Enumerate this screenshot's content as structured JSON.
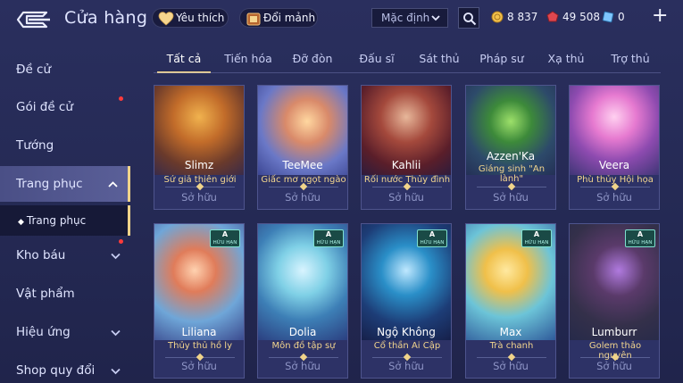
{
  "header": {
    "title": "Cửa hàng",
    "favorites_label": "Yêu thích",
    "exchange_label": "Đổi mảnh",
    "sort_value": "Mặc định",
    "currencies": {
      "gold": "8 837",
      "ruby": "49 508",
      "voucher": "0"
    }
  },
  "sidebar": {
    "items": [
      {
        "label": "Đề cử"
      },
      {
        "label": "Gói đề cử"
      },
      {
        "label": "Tướng"
      },
      {
        "label": "Trang phục"
      },
      {
        "label": "Kho báu"
      },
      {
        "label": "Vật phẩm"
      },
      {
        "label": "Hiệu ứng"
      },
      {
        "label": "Shop quy đổi"
      }
    ],
    "sub_item": "Trang phục"
  },
  "tabs": [
    {
      "label": "Tất cả"
    },
    {
      "label": "Tiến hóa"
    },
    {
      "label": "Đỡ đòn"
    },
    {
      "label": "Đấu sĩ"
    },
    {
      "label": "Sát thủ"
    },
    {
      "label": "Pháp sư"
    },
    {
      "label": "Xạ thủ"
    },
    {
      "label": "Trợ thủ"
    }
  ],
  "cards": [
    {
      "name": "Slimz",
      "skin": "Sứ giả thiên giới",
      "status": "Sở hữu"
    },
    {
      "name": "TeeMee",
      "skin": "Giấc mơ ngọt ngào",
      "status": "Sở hữu"
    },
    {
      "name": "Kahlii",
      "skin": "Rối nước Thủy đình",
      "status": "Sở hữu"
    },
    {
      "name": "Azzen'Ka",
      "skin": "Giáng sinh \"An lành\"",
      "status": "Sở hữu"
    },
    {
      "name": "Veera",
      "skin": "Phù thủy Hội họa",
      "status": "Sở hữu"
    },
    {
      "name": "Liliana",
      "skin": "Thủy thủ hồ ly",
      "status": "Sở hữu",
      "badge_grade": "A",
      "badge_text": "HỮU HẠN"
    },
    {
      "name": "Dolia",
      "skin": "Môn đồ tập sự",
      "status": "Sở hữu",
      "badge_grade": "A",
      "badge_text": "HỮU HẠN"
    },
    {
      "name": "Ngộ Không",
      "skin": "Cổ thần Ai Cập",
      "status": "Sở hữu",
      "badge_grade": "A",
      "badge_text": "HỮU HẠN"
    },
    {
      "name": "Max",
      "skin": "Trà chanh",
      "status": "Sở hữu",
      "badge_grade": "A",
      "badge_text": "HỮU HẠN"
    },
    {
      "name": "Lumburr",
      "skin": "Golem thảo nguyên",
      "status": "Sở hữu",
      "badge_grade": "A",
      "badge_text": "HỮU HẠN"
    }
  ],
  "colors": {
    "accent_gold": "#f0d48a",
    "panel": "#2d3266",
    "notification_red": "#ff3b3b"
  }
}
